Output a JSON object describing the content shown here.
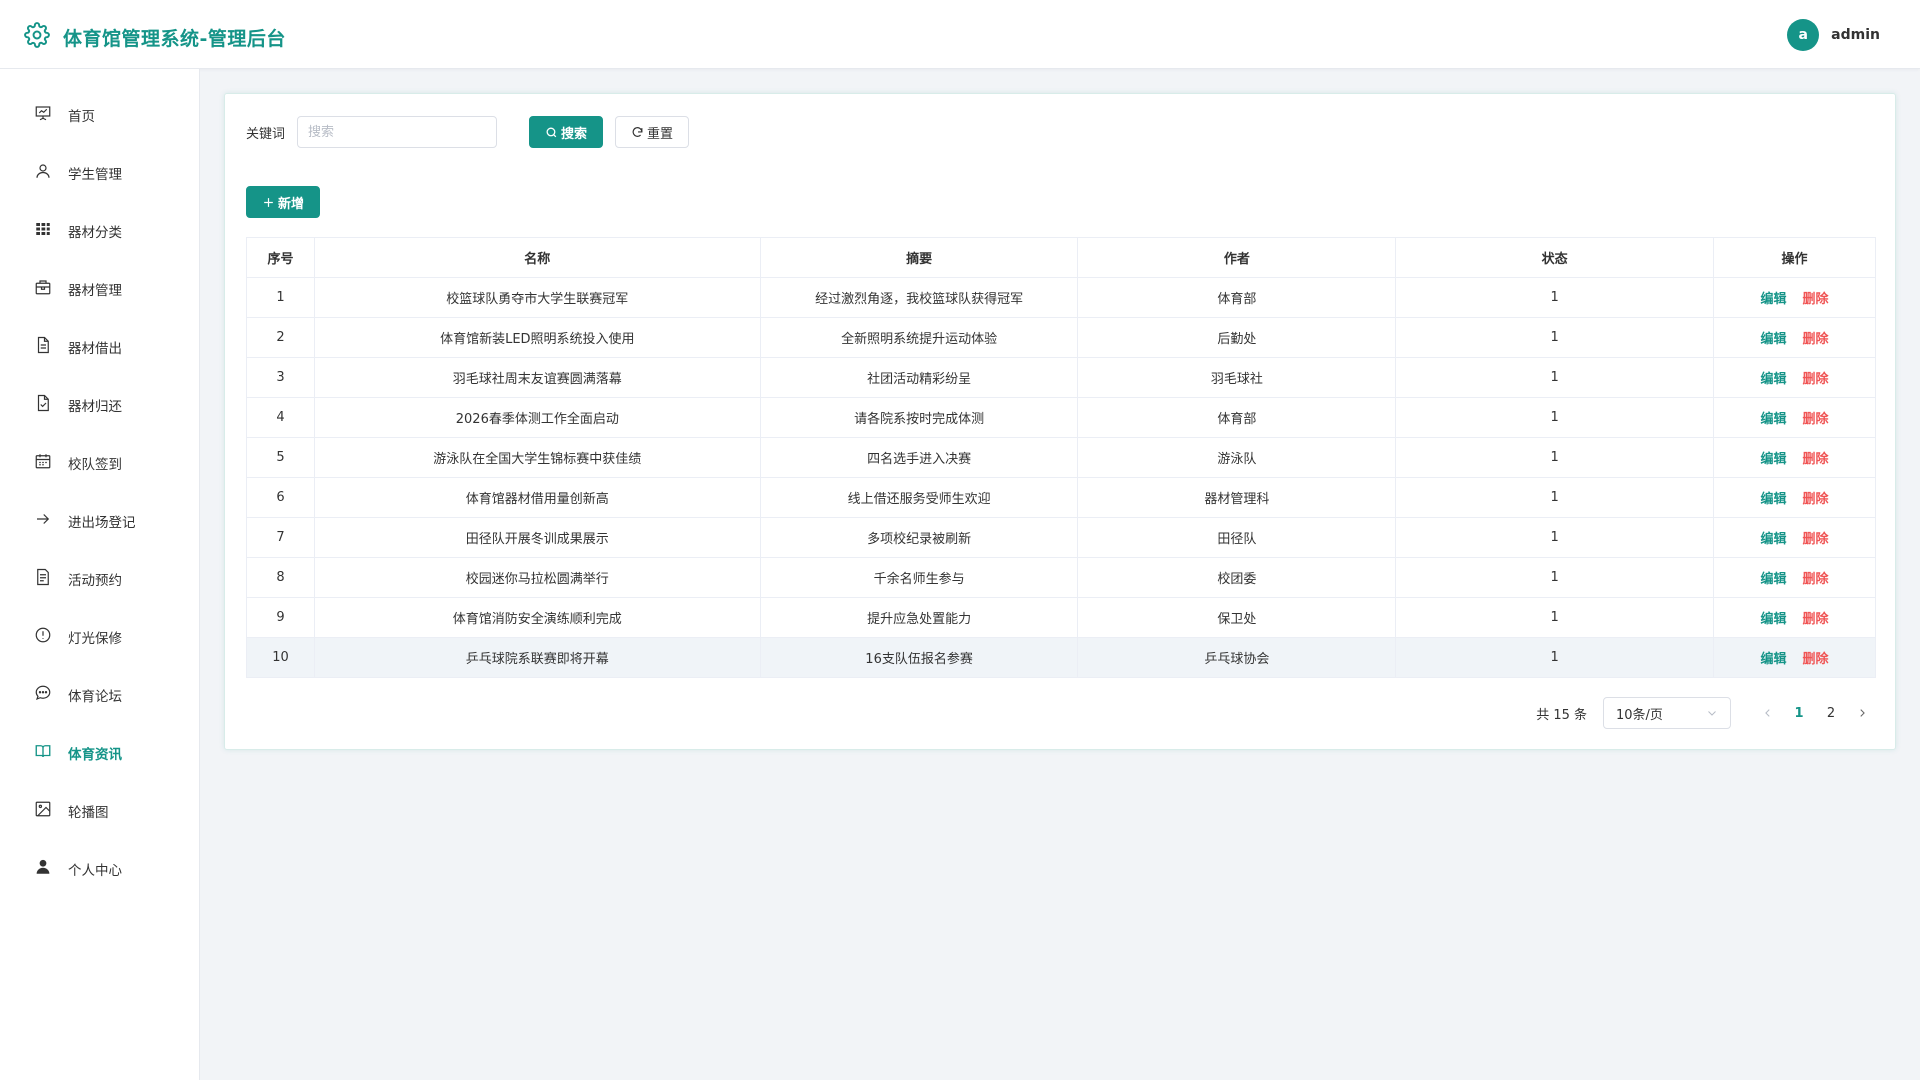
{
  "app": {
    "title": "体育馆管理系统-管理后台",
    "brand_color": "#159488",
    "logo_icon": "gear-icon"
  },
  "user": {
    "avatar_letter": "a",
    "name": "admin"
  },
  "sidebar": {
    "items": [
      {
        "label": "首页",
        "icon": "presentation-icon",
        "active": false
      },
      {
        "label": "学生管理",
        "icon": "user-icon",
        "active": false
      },
      {
        "label": "器材分类",
        "icon": "grid-icon",
        "active": false
      },
      {
        "label": "器材管理",
        "icon": "box-icon",
        "active": false
      },
      {
        "label": "器材借出",
        "icon": "document-icon",
        "active": false
      },
      {
        "label": "器材归还",
        "icon": "document-check-icon",
        "active": false
      },
      {
        "label": "校队签到",
        "icon": "calendar-icon",
        "active": false
      },
      {
        "label": "进出场登记",
        "icon": "arrow-right-icon",
        "active": false
      },
      {
        "label": "活动预约",
        "icon": "list-icon",
        "active": false
      },
      {
        "label": "灯光保修",
        "icon": "warning-icon",
        "active": false
      },
      {
        "label": "体育论坛",
        "icon": "chat-icon",
        "active": false
      },
      {
        "label": "体育资讯",
        "icon": "book-icon",
        "active": true
      },
      {
        "label": "轮播图",
        "icon": "image-icon",
        "active": false
      },
      {
        "label": "个人中心",
        "icon": "person-icon",
        "active": false
      }
    ]
  },
  "search": {
    "label": "关键词",
    "placeholder": "搜索",
    "value": "",
    "search_button": "搜索",
    "reset_button": "重置",
    "add_button": "新增"
  },
  "table": {
    "headers": [
      "序号",
      "名称",
      "摘要",
      "作者",
      "状态",
      "操作"
    ],
    "edit_label": "编辑",
    "delete_label": "删除",
    "rows": [
      {
        "no": "1",
        "name": "校篮球队勇夺市大学生联赛冠军",
        "summary": "经过激烈角逐，我校篮球队获得冠军",
        "author": "体育部",
        "status": "1"
      },
      {
        "no": "2",
        "name": "体育馆新装LED照明系统投入使用",
        "summary": "全新照明系统提升运动体验",
        "author": "后勤处",
        "status": "1"
      },
      {
        "no": "3",
        "name": "羽毛球社周末友谊赛圆满落幕",
        "summary": "社团活动精彩纷呈",
        "author": "羽毛球社",
        "status": "1"
      },
      {
        "no": "4",
        "name": "2026春季体测工作全面启动",
        "summary": "请各院系按时完成体测",
        "author": "体育部",
        "status": "1"
      },
      {
        "no": "5",
        "name": "游泳队在全国大学生锦标赛中获佳绩",
        "summary": "四名选手进入决赛",
        "author": "游泳队",
        "status": "1"
      },
      {
        "no": "6",
        "name": "体育馆器材借用量创新高",
        "summary": "线上借还服务受师生欢迎",
        "author": "器材管理科",
        "status": "1"
      },
      {
        "no": "7",
        "name": "田径队开展冬训成果展示",
        "summary": "多项校纪录被刷新",
        "author": "田径队",
        "status": "1"
      },
      {
        "no": "8",
        "name": "校园迷你马拉松圆满举行",
        "summary": "千余名师生参与",
        "author": "校团委",
        "status": "1"
      },
      {
        "no": "9",
        "name": "体育馆消防安全演练顺利完成",
        "summary": "提升应急处置能力",
        "author": "保卫处",
        "status": "1"
      },
      {
        "no": "10",
        "name": "乒乓球院系联赛即将开幕",
        "summary": "16支队伍报名参赛",
        "author": "乒乓球协会",
        "status": "1"
      }
    ]
  },
  "pagination": {
    "total_text": "共 15 条",
    "page_size": "10条/页",
    "pages": [
      "1",
      "2"
    ],
    "current_page": "1"
  }
}
